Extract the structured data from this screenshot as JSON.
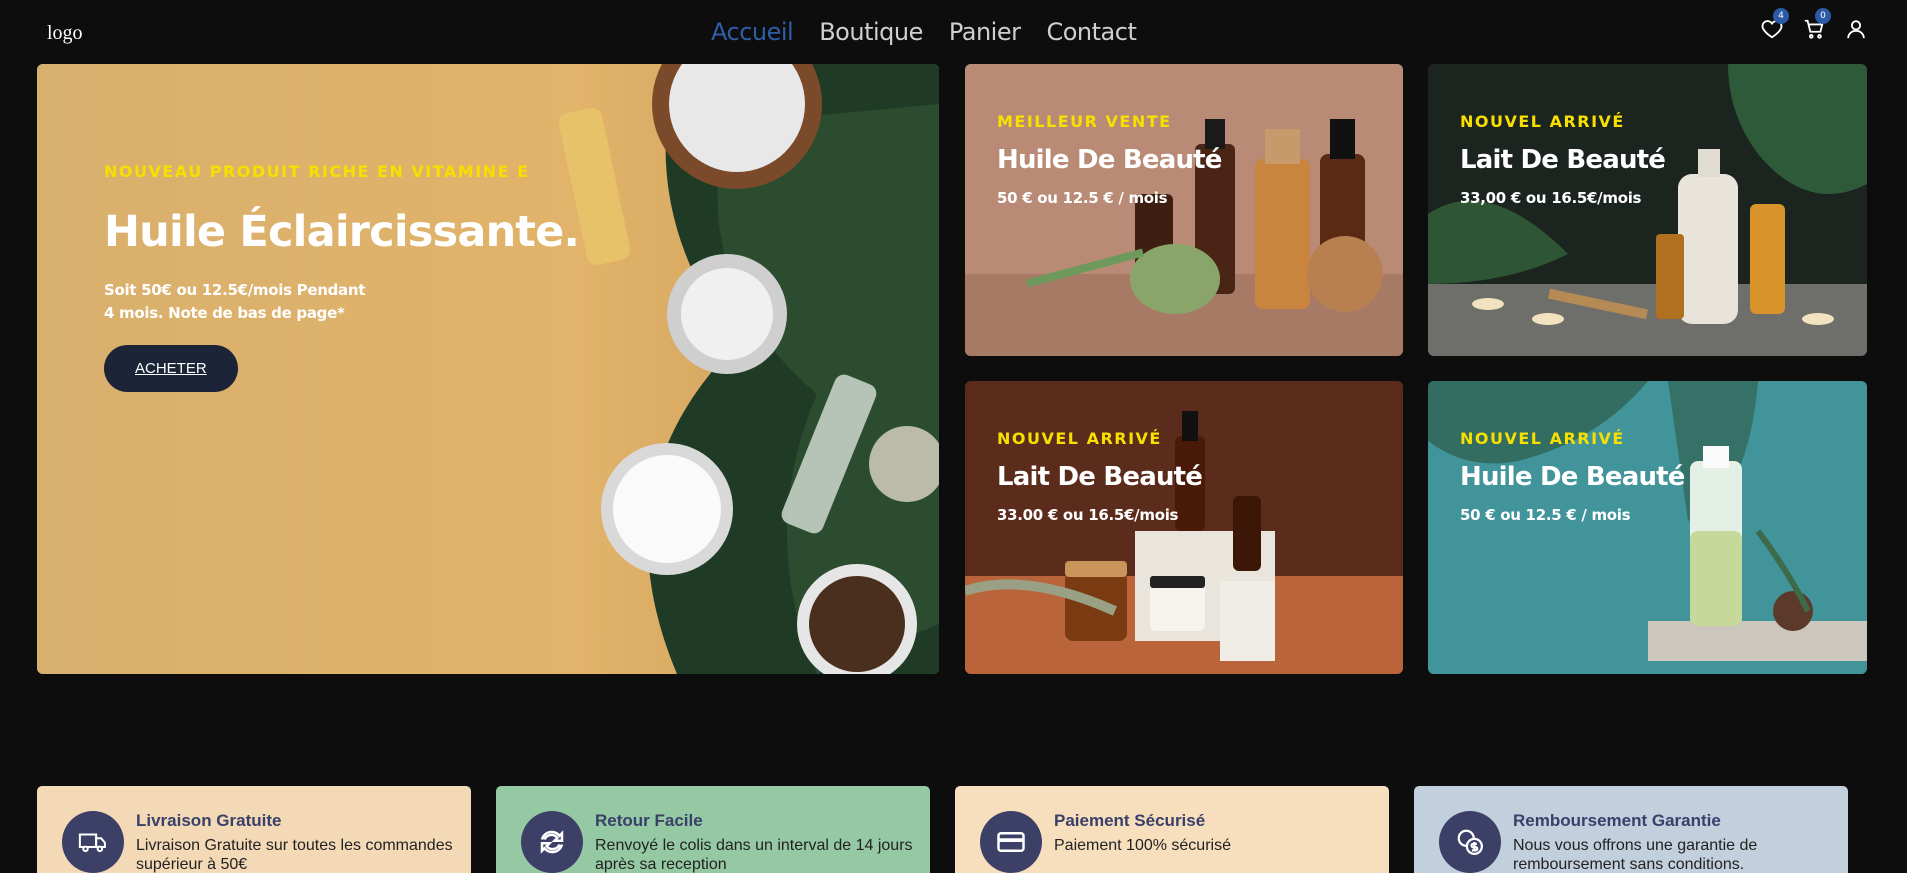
{
  "header": {
    "logo": "logo",
    "nav": [
      "Accueil",
      "Boutique",
      "Panier",
      "Contact"
    ],
    "active_nav": "Accueil",
    "wishlist_count": "4",
    "cart_count": "0"
  },
  "hero": {
    "eyebrow": "NOUVEAU PRODUIT RICHE EN VITAMINE E",
    "title": "Huile Éclaircissante.",
    "subtitle_line1": "Soit 50€ ou 12.5€/mois Pendant",
    "subtitle_line2": "4 mois. Note de bas de page*",
    "button": "ACHETER"
  },
  "cards": [
    {
      "eyebrow": "MEILLEUR VENTE",
      "title": "Huile De Beauté",
      "price": "50 € ou 12.5 € / mois"
    },
    {
      "eyebrow": "NOUVEL ARRIVÉ",
      "title": "Lait De Beauté",
      "price": "33,00 € ou 16.5€/mois"
    },
    {
      "eyebrow": "NOUVEL ARRIVÉ",
      "title": "Lait De Beauté",
      "price": "33.00 € ou 16.5€/mois"
    },
    {
      "eyebrow": "NOUVEL ARRIVÉ",
      "title": "Huile De Beauté",
      "price": "50 € ou 12.5 € / mois"
    }
  ],
  "features": [
    {
      "icon": "truck-icon",
      "title": "Livraison Gratuite",
      "desc": "Livraison Gratuite sur toutes les commandes supérieur à 50€"
    },
    {
      "icon": "refresh-icon",
      "title": "Retour Facile",
      "desc": "Renvoyé le colis dans un interval de 14 jours après sa reception"
    },
    {
      "icon": "credit-card-icon",
      "title": "Paiement Sécurisé",
      "desc": "Paiement 100% sécurisé"
    },
    {
      "icon": "money-back-icon",
      "title": "Remboursement Garantie",
      "desc": "Nous vous offrons une garantie de remboursement sans conditions."
    }
  ],
  "colors": {
    "accent": "#2f5ea8",
    "eyebrow": "#f7e000",
    "button": "#1b2537",
    "feature_icon_bg": "#3d4066"
  }
}
